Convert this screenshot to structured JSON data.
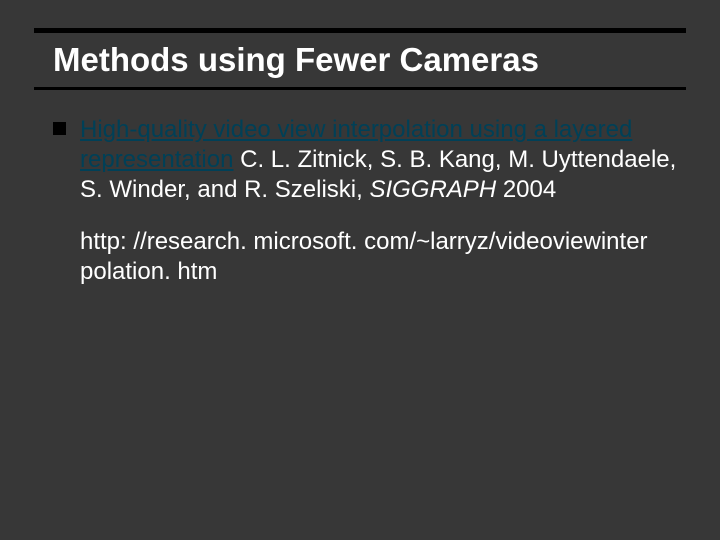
{
  "title": "Methods using Fewer Cameras",
  "bullet": {
    "paper_title": "High-quality video view interpolation using a layered representation",
    "authors_prefix": " ",
    "authors": "C. L. Zitnick, S. B. Kang, M. Uyttendaele, S. Winder, and R. Szeliski, ",
    "venue": "SIGGRAPH",
    "year": " 2004"
  },
  "url": "http: //research. microsoft. com/~larryz/videoviewinter polation. htm"
}
